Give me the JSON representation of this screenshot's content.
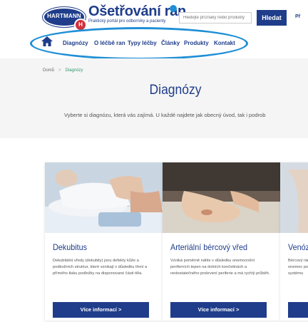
{
  "header": {
    "logo_text": "HARTMANN",
    "logo_badge": "H",
    "site_title": "Ošetřování ran",
    "tagline": "Praktický portál pro odborníky a pacienty",
    "search_placeholder": "Hledejte příznaky nebo produkty",
    "search_button": "Hledat",
    "cut_text": "Př"
  },
  "nav": {
    "items": [
      "Diagnózy",
      "O léčbě ran",
      "Typy léčby",
      "Články",
      "Produkty",
      "Kontakt"
    ]
  },
  "breadcrumb": {
    "home": "Domů",
    "separator": ">",
    "current": "Diagnózy"
  },
  "page": {
    "title": "Diagnózy",
    "intro": "Vyberte si diagnózu, která vás zajímá. U každé najdete jak obecný úvod, tak i podrob"
  },
  "cards": [
    {
      "title": "Dekubitus",
      "desc": "Dekubitální vředy (dekubity) jsou defekty kůže a podkožních struktur, které vznikají v důsledku tření a přímého tlaku podložky na disponované části těla.",
      "button": "Více informací >"
    },
    {
      "title": "Arteriální bércový vřed",
      "desc": "Vzniká poměrně náhle v důsledku onemocnění periferních tepen na dolních končetinách a nedostatečného prokrvení periferie a má rychlý průběh.",
      "button": "Více informací >"
    },
    {
      "title": "Venóz",
      "desc": "Bércový ránou a onemoc postižen systému",
      "button": ""
    }
  ],
  "colors": {
    "brand": "#1f3d8a",
    "highlight": "#1f8fd6",
    "breadcrumb_current": "#2e9b6a"
  }
}
